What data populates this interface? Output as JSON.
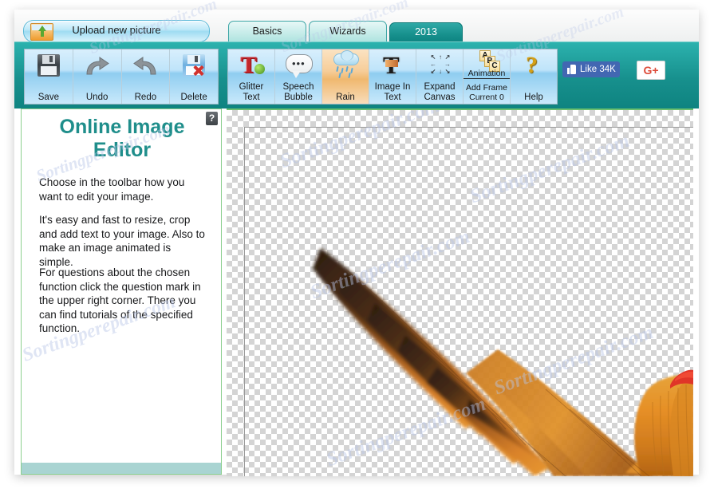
{
  "app": {
    "upload_button": "Upload new picture",
    "upload_icon": "image-upload-icon"
  },
  "tabs": [
    {
      "label": "Basics",
      "active": false
    },
    {
      "label": "Wizards",
      "active": false
    },
    {
      "label": "2013",
      "active": true
    }
  ],
  "toolbar": {
    "left_group": [
      {
        "label": "Save",
        "icon": "floppy-disk-icon"
      },
      {
        "label": "Undo",
        "icon": "undo-arrow-icon"
      },
      {
        "label": "Redo",
        "icon": "redo-arrow-icon"
      },
      {
        "label": "Delete",
        "icon": "floppy-delete-icon"
      }
    ],
    "main_group": [
      {
        "label": "Glitter Text",
        "line1": "Glitter",
        "line2": "Text",
        "icon": "glitter-letter-icon",
        "selected": false
      },
      {
        "label": "Speech Bubble",
        "line1": "Speech",
        "line2": "Bubble",
        "icon": "speech-bubble-icon",
        "selected": false
      },
      {
        "label": "Rain",
        "line1": "Rain",
        "line2": "",
        "icon": "rain-cloud-icon",
        "selected": true
      },
      {
        "label": "Image In Text",
        "line1": "Image In",
        "line2": "Text",
        "icon": "image-in-text-icon",
        "selected": false
      },
      {
        "label": "Expand Canvas",
        "line1": "Expand",
        "line2": "Canvas",
        "icon": "expand-arrows-icon",
        "selected": false
      },
      {
        "label": "Animation",
        "line1": "Add Frame",
        "line2": "Current 0",
        "icon": "animation-frames-icon",
        "selected": false
      },
      {
        "label": "Help",
        "line1": "Help",
        "line2": "",
        "icon": "question-mark-icon",
        "selected": false
      }
    ],
    "animation_title": "Animation"
  },
  "social": {
    "facebook_like": "Like",
    "facebook_count": "34K",
    "google_plus": "G+"
  },
  "sidebar": {
    "help_badge": "?",
    "title": "Online Image Editor",
    "paragraphs": [
      "Choose in the toolbar how you want to edit your image.",
      "It's easy and fast to resize, crop and add text to your image. Also to make an image animated is simple.",
      "For questions about the chosen function click the question mark in the upper right corner. There you can find tutorials of the specified function."
    ]
  },
  "canvas": {
    "alt": "rooster-with-spread-wings-transparent-background",
    "watermark": "Sortingperepair.com"
  },
  "colors": {
    "toolbar_teal": "#17908d",
    "title_teal": "#1f8e8b",
    "selected_tool": "#f0b86f",
    "facebook_blue": "#4267b2",
    "google_red": "#dd4b39",
    "canvas_border_green": "#6bbf6e"
  }
}
